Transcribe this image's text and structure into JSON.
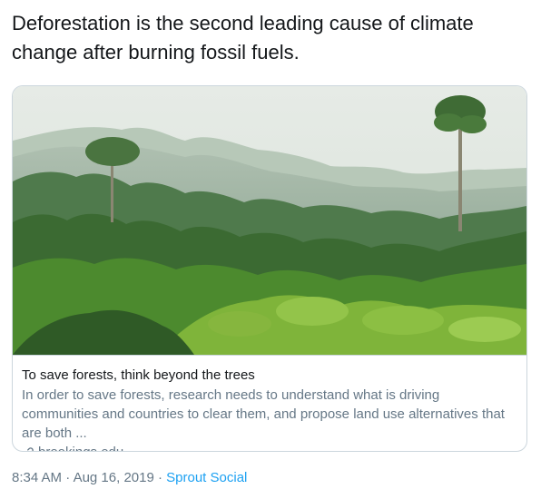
{
  "tweet": {
    "text": "Deforestation is the second leading cause of climate change after burning fossil fuels."
  },
  "card": {
    "image_alt": "Tropical rainforest canopy in the mist",
    "title": "To save forests, think beyond the trees",
    "description": "In order to save forests, research needs to understand what is driving communities and countries to clear them, and propose land use alternatives that are both ...",
    "domain": "brookings.edu",
    "domain_icon": "link-icon"
  },
  "meta": {
    "time": "8:34 AM",
    "separator_1": " · ",
    "date": "Aug 16, 2019",
    "separator_2": " · ",
    "source": "Sprout Social"
  },
  "colors": {
    "text": "#14171a",
    "secondary_text": "#657786",
    "link": "#1da1f2",
    "border": "#ccd6dd"
  }
}
